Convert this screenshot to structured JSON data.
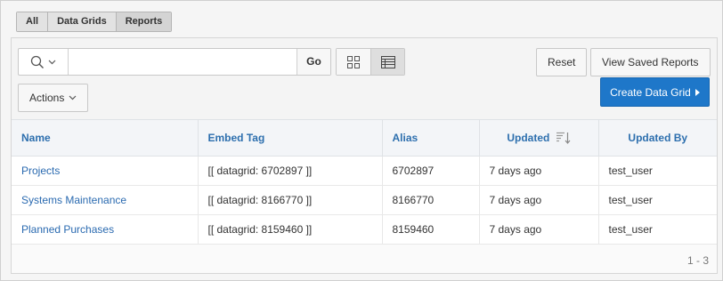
{
  "filters": [
    {
      "label": "All"
    },
    {
      "label": "Data Grids"
    },
    {
      "label": "Reports"
    }
  ],
  "search": {
    "placeholder": "",
    "go_label": "Go",
    "type_icon": "search-icon"
  },
  "views": {
    "grid_icon": "grid-view-icon",
    "report_icon": "report-view-icon",
    "active": "report"
  },
  "toolbar": {
    "reset_label": "Reset",
    "saved_reports_label": "View Saved Reports",
    "actions_label": "Actions",
    "create_label": "Create Data Grid"
  },
  "table": {
    "columns": [
      "Name",
      "Embed Tag",
      "Alias",
      "Updated",
      "Updated By"
    ],
    "sorted_column": "Updated",
    "rows": [
      {
        "name": "Projects",
        "embed": "[[ datagrid: 6702897 ]]",
        "alias": "6702897",
        "updated": "7 days ago",
        "by": "test_user"
      },
      {
        "name": "Systems Maintenance",
        "embed": "[[ datagrid: 8166770 ]]",
        "alias": "8166770",
        "updated": "7 days ago",
        "by": "test_user"
      },
      {
        "name": "Planned Purchases",
        "embed": "[[ datagrid: 8159460 ]]",
        "alias": "8159460",
        "updated": "7 days ago",
        "by": "test_user"
      }
    ]
  },
  "pagination": {
    "text": "1 - 3"
  },
  "colors": {
    "accent": "#1e77c9",
    "link": "#2a6ab0",
    "header_text": "#2d6fae"
  }
}
